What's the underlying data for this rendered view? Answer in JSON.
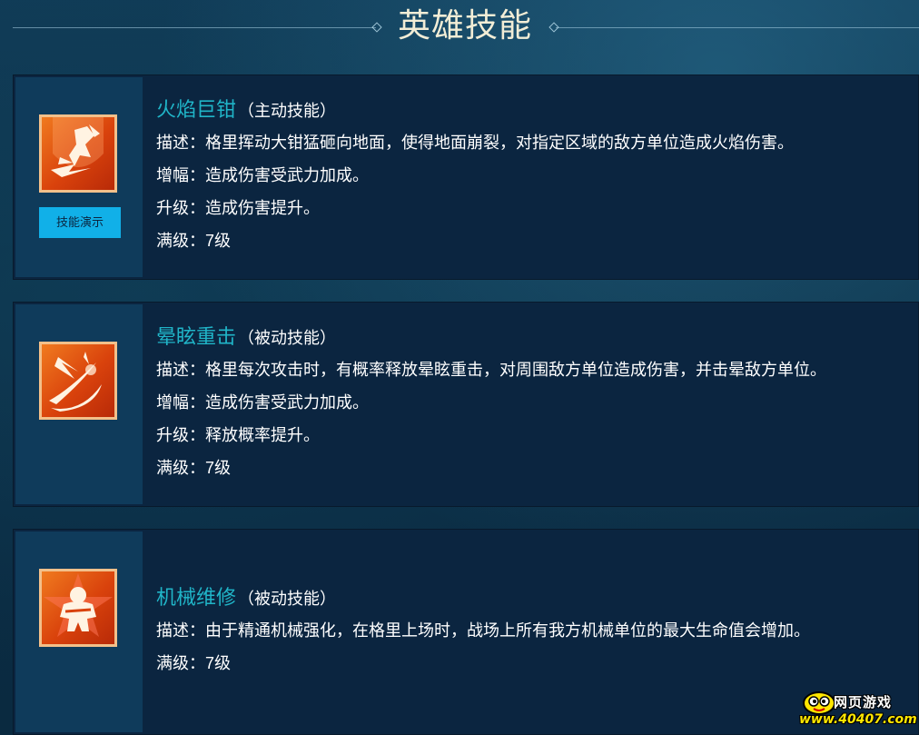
{
  "page": {
    "title": "英雄技能"
  },
  "skills": [
    {
      "name": "火焰巨钳",
      "type": "（主动技能）",
      "icon": "flame-pincer-icon",
      "demo_label": "技能演示",
      "lines": [
        "描述：格里挥动大钳猛砸向地面，使得地面崩裂，对指定区域的敌方单位造成火焰伤害。",
        "增幅：造成伤害受武力加成。",
        "升级：造成伤害提升。",
        "满级：7级"
      ]
    },
    {
      "name": "晕眩重击",
      "type": "（被动技能）",
      "icon": "stun-strike-icon",
      "lines": [
        "描述：格里每次攻击时，有概率释放晕眩重击，对周围敌方单位造成伤害，并击晕敌方单位。",
        "增幅：造成伤害受武力加成。",
        "升级：释放概率提升。",
        "满级：7级"
      ]
    },
    {
      "name": "机械维修",
      "type": "（被动技能）",
      "icon": "mech-repair-icon",
      "lines": [
        "描述：由于精通机械强化，在格里上场时，战场上所有我方机械单位的最大生命值会增加。",
        "满级：7级"
      ]
    }
  ],
  "watermark": {
    "top": "网页游戏",
    "bottom": "www.40407.com"
  },
  "colors": {
    "skill_name": "#20b5c8",
    "demo_button": "#11b0e8",
    "icon_border": "#f3c08a",
    "title": "#f2edd6"
  }
}
